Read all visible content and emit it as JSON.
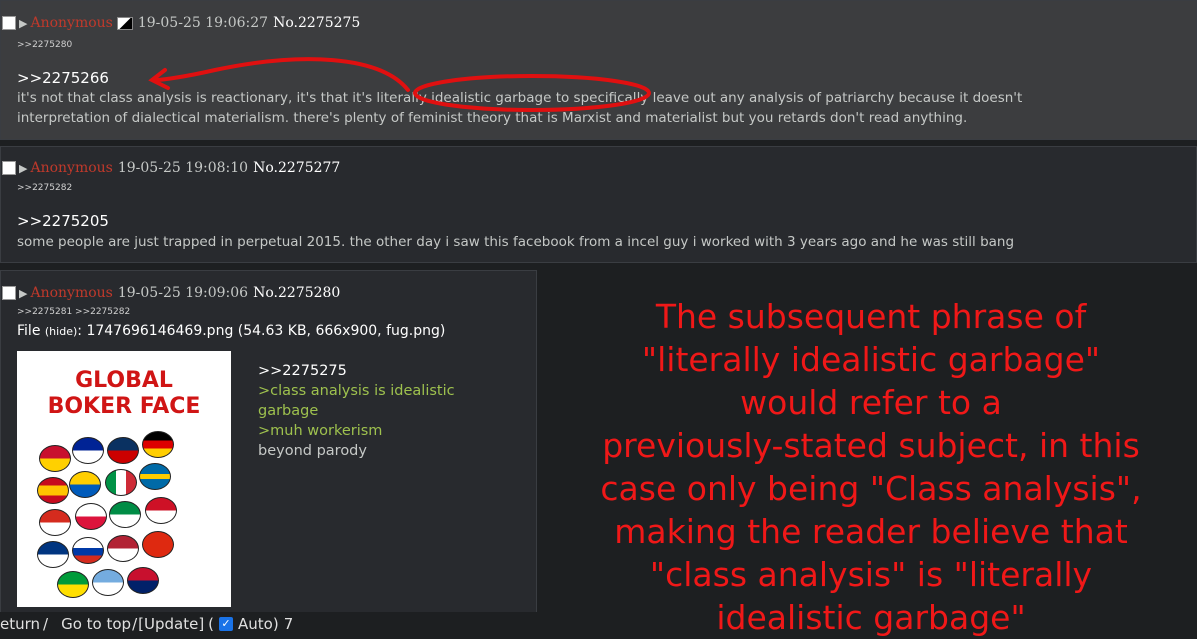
{
  "posts": [
    {
      "name": "Anonymous",
      "date": "19-05-25 19:06:27",
      "no": "No.2275275",
      "replies": ">>2275280",
      "quote": ">>2275266",
      "line1": "it's not that class analysis is reactionary, it's that it's literally idealistic garbage to specifically leave out any analysis of patriarchy because it doesn't",
      "line2": "interpretation of dialectical materialism. there's plenty of feminist theory that is Marxist and materialist but you retards don't read anything."
    },
    {
      "name": "Anonymous",
      "date": "19-05-25 19:08:10",
      "no": "No.2275277",
      "replies": ">>2275282",
      "quote": ">>2275205",
      "line1": "some people are just trapped in perpetual 2015. the other day i saw this facebook from a incel guy i worked with 3 years ago and he was still bang"
    },
    {
      "name": "Anonymous",
      "date": "19-05-25 19:09:06",
      "no": "No.2275280",
      "replies": ">>2275281 >>2275282",
      "file_prefix": "File",
      "file_hide": "(hide)",
      "file_name": "1747696146469.png",
      "file_meta": "(54.63 KB, 666x900, fug.png)",
      "image_title_1": "GLOBAL",
      "image_title_2": "BOKER FACE",
      "quote": ">>2275275",
      "green1": ">class analysis is idealistic",
      "green1b": "garbage",
      "green2": ">muh workerism",
      "text": "beyond parody"
    }
  ],
  "caption": {
    "lines": [
      "The subsequent phrase of",
      "\"literally idealistic garbage\"",
      "would refer to a",
      "previously-stated subject, in this",
      "case only being \"Class analysis\",",
      "making the reader believe that",
      "\"class analysis\" is \"literally",
      "idealistic garbage\""
    ],
    "color": "#f01818"
  },
  "navbar": {
    "return": "eturn",
    "sep1": "/",
    "top": "Go to top",
    "sep2": "/",
    "update": "[Update]",
    "paren_open": "(",
    "auto": "Auto)",
    "count": "7"
  },
  "colors": {
    "background": "#1d1f21",
    "post_bg": "#282a2e",
    "name": "#c0392b",
    "greentext": "#9ec14e",
    "annotation": "#e01010"
  }
}
